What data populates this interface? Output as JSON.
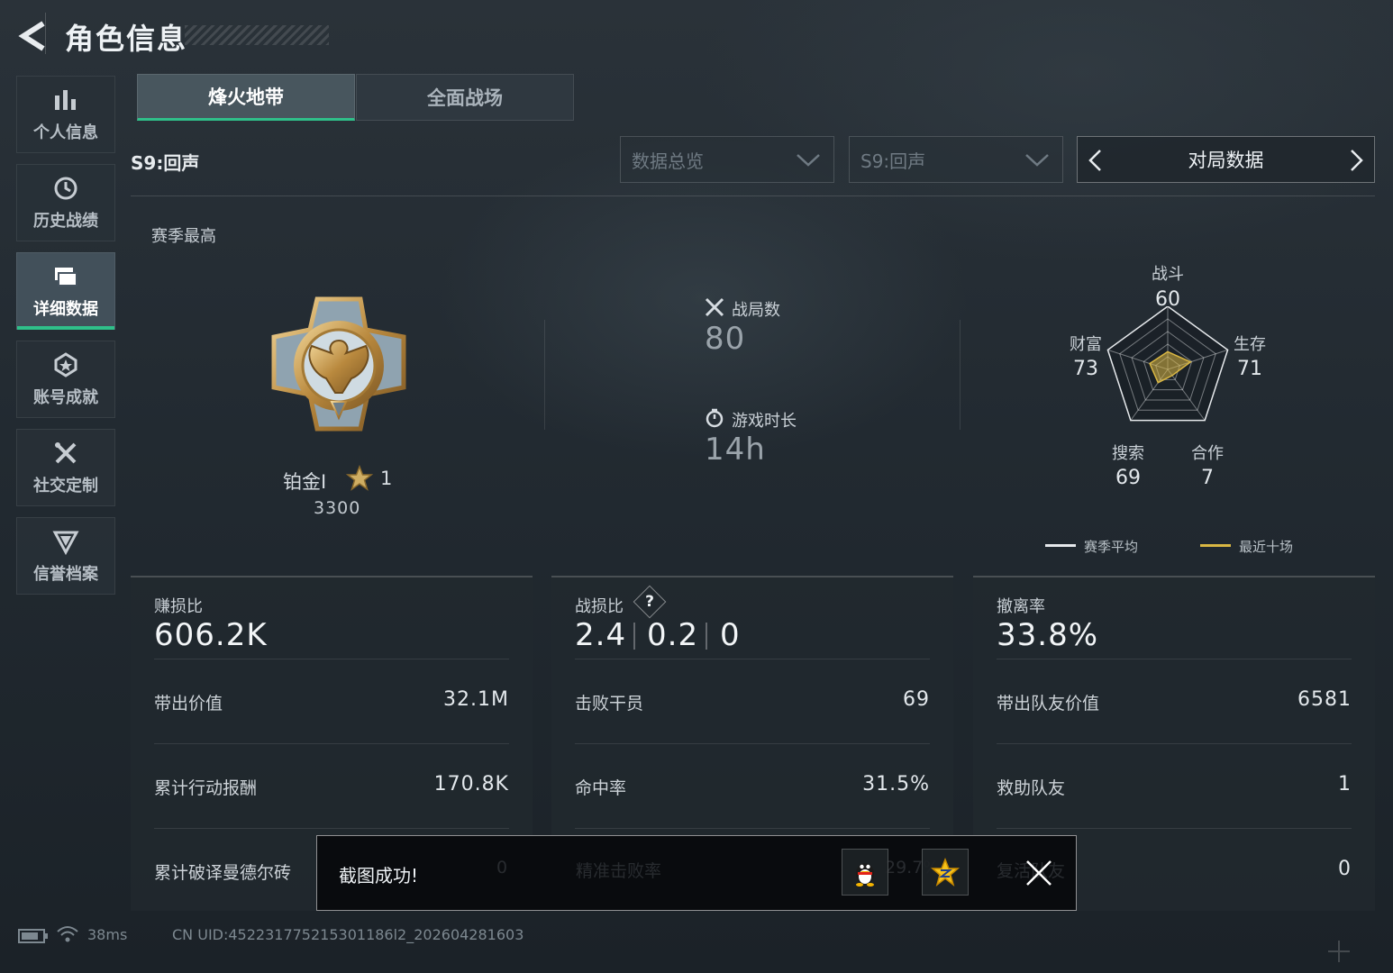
{
  "header": {
    "title": "角色信息"
  },
  "sidebar": {
    "items": [
      {
        "label": "个人信息",
        "icon": "bar-chart-icon"
      },
      {
        "label": "历史战绩",
        "icon": "history-clock-icon"
      },
      {
        "label": "详细数据",
        "icon": "folder-icon",
        "active": true
      },
      {
        "label": "账号成就",
        "icon": "achievement-icon"
      },
      {
        "label": "社交定制",
        "icon": "tools-icon"
      },
      {
        "label": "信誉档案",
        "icon": "shield-badge-icon"
      }
    ]
  },
  "tabs": [
    {
      "label": "烽火地带",
      "active": true
    },
    {
      "label": "全面战场",
      "active": false
    }
  ],
  "season": {
    "label": "S9:回声"
  },
  "filters": {
    "view": "数据总览",
    "season": "S9:回声",
    "switcher": "对局数据"
  },
  "peak": {
    "label": "赛季最高",
    "rank": "铂金Ⅰ",
    "stars": "1",
    "score": "3300"
  },
  "summary": {
    "matches_label": "战局数",
    "matches_value": "80",
    "playtime_label": "游戏时长",
    "playtime_value": "14h"
  },
  "radar": {
    "axes": [
      {
        "label": "战斗",
        "value": "60"
      },
      {
        "label": "生存",
        "value": "71"
      },
      {
        "label": "合作",
        "value": "7"
      },
      {
        "label": "搜索",
        "value": "69"
      },
      {
        "label": "财富",
        "value": "73"
      }
    ],
    "legend": {
      "season_avg": "赛季平均",
      "recent_ten": "最近十场",
      "season_color": "#e6e9ec",
      "recent_color": "#d9b743"
    },
    "recent_shape": [
      0.28,
      0.38,
      0.12,
      0.26,
      0.3
    ]
  },
  "cards": [
    {
      "title": "赚损比",
      "value": "606.2K",
      "rows": [
        {
          "label": "带出价值",
          "value": "32.1M"
        },
        {
          "label": "累计行动报酬",
          "value": "170.8K"
        },
        {
          "label": "累计破译曼德尔砖",
          "value": "0"
        }
      ]
    },
    {
      "title": "战损比",
      "help": "?",
      "values": [
        "2.4",
        "0.2",
        "0"
      ],
      "rows": [
        {
          "label": "击败干员",
          "value": "69"
        },
        {
          "label": "命中率",
          "value": "31.5%"
        },
        {
          "label": "精准击败率",
          "value": "29.7%"
        }
      ]
    },
    {
      "title": "撤离率",
      "value": "33.8%",
      "rows": [
        {
          "label": "带出队友价值",
          "value": "6581"
        },
        {
          "label": "救助队友",
          "value": "1"
        },
        {
          "label": "复活队友",
          "value": "0"
        }
      ]
    }
  ],
  "toast": {
    "message": "截图成功!"
  },
  "status": {
    "ping": "38ms",
    "uid": "CN UID:452231775215301186l2_202604281603"
  },
  "colors": {
    "accent": "#2fc08a",
    "gold": "#d9b743"
  }
}
